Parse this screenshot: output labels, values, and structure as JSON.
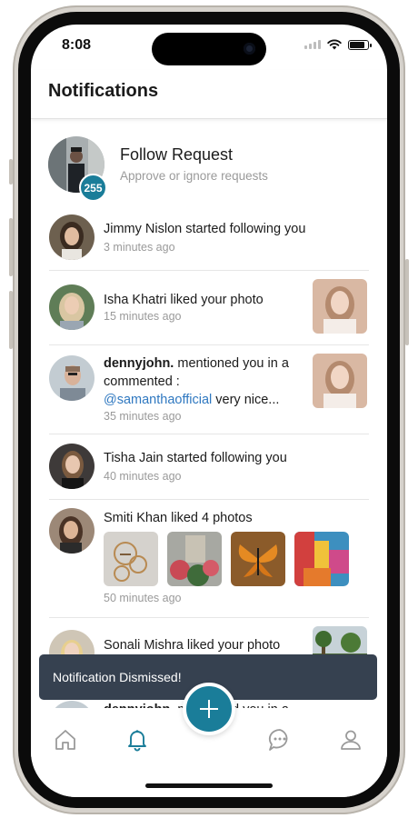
{
  "status_bar": {
    "time": "8:08"
  },
  "header": {
    "title": "Notifications"
  },
  "follow_request": {
    "title": "Follow Request",
    "subtitle": "Approve or ignore requests",
    "count": "255"
  },
  "notifications": [
    {
      "text": "Jimmy Nislon started following you",
      "time": "3 minutes ago"
    },
    {
      "text": "Isha Khatri liked your photo",
      "time": "15 minutes ago"
    },
    {
      "user": "dennyjohn.",
      "text_after_user": " mentioned you in a commented :",
      "mention": "@samanthaofficial",
      "text_after_mention": " very nice...",
      "time": "35 minutes ago"
    },
    {
      "text": "Tisha Jain started following you",
      "time": "40 minutes ago"
    },
    {
      "text": "Smiti Khan liked 4 photos",
      "time": "50 minutes ago"
    },
    {
      "text": "Sonali Mishra liked your photo"
    },
    {
      "user": "dennyjohn.",
      "text_after_user": " mentioned you in a"
    }
  ],
  "toast": {
    "message": "Notification Dismissed!"
  },
  "colors": {
    "accent": "#1a7d99",
    "mention": "#2f78c0",
    "toast": "#364150"
  },
  "tab_bar": {
    "icons": [
      "home-icon",
      "bell-icon",
      "plus-icon",
      "chat-icon",
      "profile-icon"
    ]
  }
}
